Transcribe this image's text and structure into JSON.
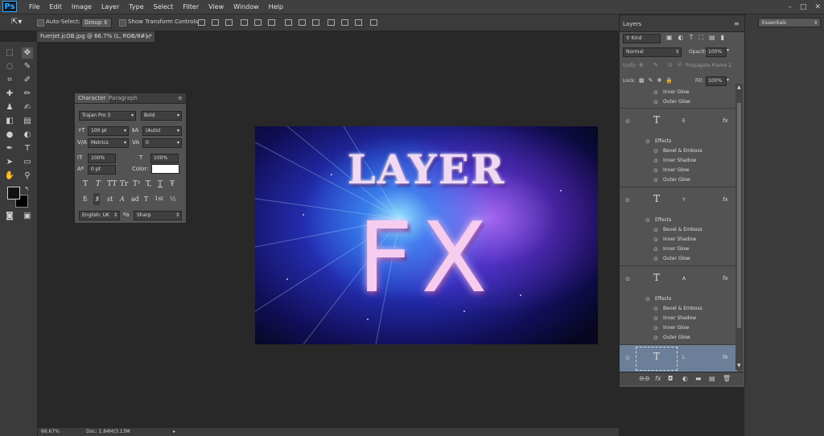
{
  "app": {
    "logo": "Ps"
  },
  "menu": [
    "File",
    "Edit",
    "Image",
    "Layer",
    "Type",
    "Select",
    "Filter",
    "View",
    "Window",
    "Help"
  ],
  "window_controls": {
    "minimize": "–",
    "maximize": "□",
    "close": "✕"
  },
  "options_bar": {
    "auto_select_label": "Auto-Select:",
    "auto_select_value": "Group",
    "show_transform_label": "Show Transform Controls"
  },
  "workspace": {
    "value": "Essentials"
  },
  "document": {
    "tab_title": "Fuerjet.jcOB.jpg @ 66.7% (L, RGB/8#) *",
    "close": "×"
  },
  "artwork": {
    "title": "LAYER",
    "subtitle": "FX"
  },
  "status_bar": {
    "zoom": "66.67%",
    "doc": "Doc: 1.84M/3.13M"
  },
  "character_panel": {
    "tab_character": "Character",
    "tab_paragraph": "Paragraph",
    "font_family": "Trajan Pro 3",
    "font_style": "Bold",
    "font_size": "100 pt",
    "leading": "(Auto)",
    "kerning": "Metrics",
    "tracking": "0",
    "vertical_scale": "100%",
    "horizontal_scale": "100%",
    "baseline_shift": "0 pt",
    "color_label": "Color:",
    "color_value": "#ffffff",
    "type_buttons": [
      "T",
      "T",
      "TT",
      "Tr",
      "T¹",
      "T,",
      "T",
      "Ŧ"
    ],
    "opentype_buttons": [
      "fi",
      "ꝸ",
      "st",
      "A",
      "ad",
      "T",
      "1st",
      "½"
    ],
    "language": "English: UK",
    "antialias": "Sharp"
  },
  "layers_panel": {
    "title": "Layers",
    "filter_kind": "Kind",
    "blend_mode": "Normal",
    "opacity_label": "Opacity:",
    "opacity_value": "100%",
    "unify_label": "Unify:",
    "propagate_label": "Propagate Frame 1",
    "lock_label": "Lock:",
    "fill_label": "Fill:",
    "fill_value": "100%",
    "top_effects": [
      "Inner Glow",
      "Outer Glow"
    ],
    "effects_label": "Effects",
    "layers": [
      {
        "name": "E",
        "effects": [
          "Bevel & Emboss",
          "Inner Shadow",
          "Inner Glow",
          "Outer Glow"
        ]
      },
      {
        "name": "Y",
        "effects": [
          "Bevel & Emboss",
          "Inner Shadow",
          "Inner Glow",
          "Outer Glow"
        ]
      },
      {
        "name": "A",
        "effects": [
          "Bevel & Emboss",
          "Inner Shadow",
          "Inner Glow",
          "Outer Glow"
        ]
      },
      {
        "name": "L",
        "effects": []
      }
    ]
  }
}
